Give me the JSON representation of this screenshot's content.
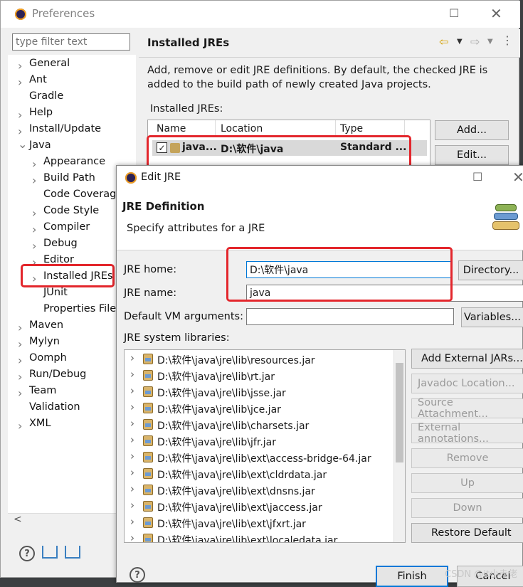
{
  "preferences": {
    "title": "Preferences",
    "filter_placeholder": "type filter text",
    "tree": [
      {
        "label": "General",
        "indent": 0,
        "chev": "right"
      },
      {
        "label": "Ant",
        "indent": 0,
        "chev": "right"
      },
      {
        "label": "Gradle",
        "indent": 0,
        "chev": ""
      },
      {
        "label": "Help",
        "indent": 0,
        "chev": "right"
      },
      {
        "label": "Install/Update",
        "indent": 0,
        "chev": "right"
      },
      {
        "label": "Java",
        "indent": 0,
        "chev": "down"
      },
      {
        "label": "Appearance",
        "indent": 1,
        "chev": "right"
      },
      {
        "label": "Build Path",
        "indent": 1,
        "chev": "right"
      },
      {
        "label": "Code Coverag",
        "indent": 1,
        "chev": ""
      },
      {
        "label": "Code Style",
        "indent": 1,
        "chev": "right"
      },
      {
        "label": "Compiler",
        "indent": 1,
        "chev": "right"
      },
      {
        "label": "Debug",
        "indent": 1,
        "chev": "right"
      },
      {
        "label": "Editor",
        "indent": 1,
        "chev": "right"
      },
      {
        "label": "Installed JREs",
        "indent": 1,
        "chev": "right"
      },
      {
        "label": "JUnit",
        "indent": 1,
        "chev": ""
      },
      {
        "label": "Properties File",
        "indent": 1,
        "chev": ""
      },
      {
        "label": "Maven",
        "indent": 0,
        "chev": "right"
      },
      {
        "label": "Mylyn",
        "indent": 0,
        "chev": "right"
      },
      {
        "label": "Oomph",
        "indent": 0,
        "chev": "right"
      },
      {
        "label": "Run/Debug",
        "indent": 0,
        "chev": "right"
      },
      {
        "label": "Team",
        "indent": 0,
        "chev": "right"
      },
      {
        "label": "Validation",
        "indent": 0,
        "chev": ""
      },
      {
        "label": "XML",
        "indent": 0,
        "chev": "right"
      }
    ],
    "page_title": "Installed JREs",
    "page_description": "Add, remove or edit JRE definitions. By default, the checked JRE is added to the build path of newly created Java projects.",
    "installed_label": "Installed JREs:",
    "table_headers": {
      "name": "Name",
      "location": "Location",
      "type": "Type"
    },
    "table_row": {
      "name": "java...",
      "location": "D:\\软件\\java",
      "type": "Standard ..."
    },
    "buttons": {
      "add": "Add...",
      "edit": "Edit..."
    },
    "icons": [
      "eclipse-icon",
      "back-arrow-icon",
      "forward-arrow-icon",
      "menu-kebab-icon",
      "help-icon",
      "import-icon",
      "export-icon"
    ]
  },
  "edit_jre": {
    "title": "Edit JRE",
    "heading": "JRE Definition",
    "subheading": "Specify attributes for a JRE",
    "home_label": "JRE home:",
    "home_value": "D:\\软件\\java",
    "name_label": "JRE name:",
    "name_value": "java",
    "vm_label": "Default VM arguments:",
    "vm_value": "",
    "libs_label": "JRE system libraries:",
    "directory_button": "Directory...",
    "variables_button": "Variables...",
    "libraries": [
      "D:\\软件\\java\\jre\\lib\\resources.jar",
      "D:\\软件\\java\\jre\\lib\\rt.jar",
      "D:\\软件\\java\\jre\\lib\\jsse.jar",
      "D:\\软件\\java\\jre\\lib\\jce.jar",
      "D:\\软件\\java\\jre\\lib\\charsets.jar",
      "D:\\软件\\java\\jre\\lib\\jfr.jar",
      "D:\\软件\\java\\jre\\lib\\ext\\access-bridge-64.jar",
      "D:\\软件\\java\\jre\\lib\\ext\\cldrdata.jar",
      "D:\\软件\\java\\jre\\lib\\ext\\dnsns.jar",
      "D:\\软件\\java\\jre\\lib\\ext\\jaccess.jar",
      "D:\\软件\\java\\jre\\lib\\ext\\jfxrt.jar",
      "D:\\软件\\java\\jre\\lib\\ext\\localedata.jar"
    ],
    "side_buttons": [
      {
        "label": "Add External JARs...",
        "enabled": true
      },
      {
        "label": "Javadoc Location...",
        "enabled": false
      },
      {
        "label": "Source Attachment...",
        "enabled": false
      },
      {
        "label": "External annotations...",
        "enabled": false
      },
      {
        "label": "Remove",
        "enabled": false
      },
      {
        "label": "Up",
        "enabled": false
      },
      {
        "label": "Down",
        "enabled": false
      },
      {
        "label": "Restore Default",
        "enabled": true
      }
    ],
    "finish_button": "Finish",
    "cancel_button": "Cancel"
  },
  "watermark": "CSDN @it小赤佬",
  "colors": {
    "highlight": "#e3262c",
    "selection": "#d9d9d9",
    "focus": "#0078d7"
  }
}
